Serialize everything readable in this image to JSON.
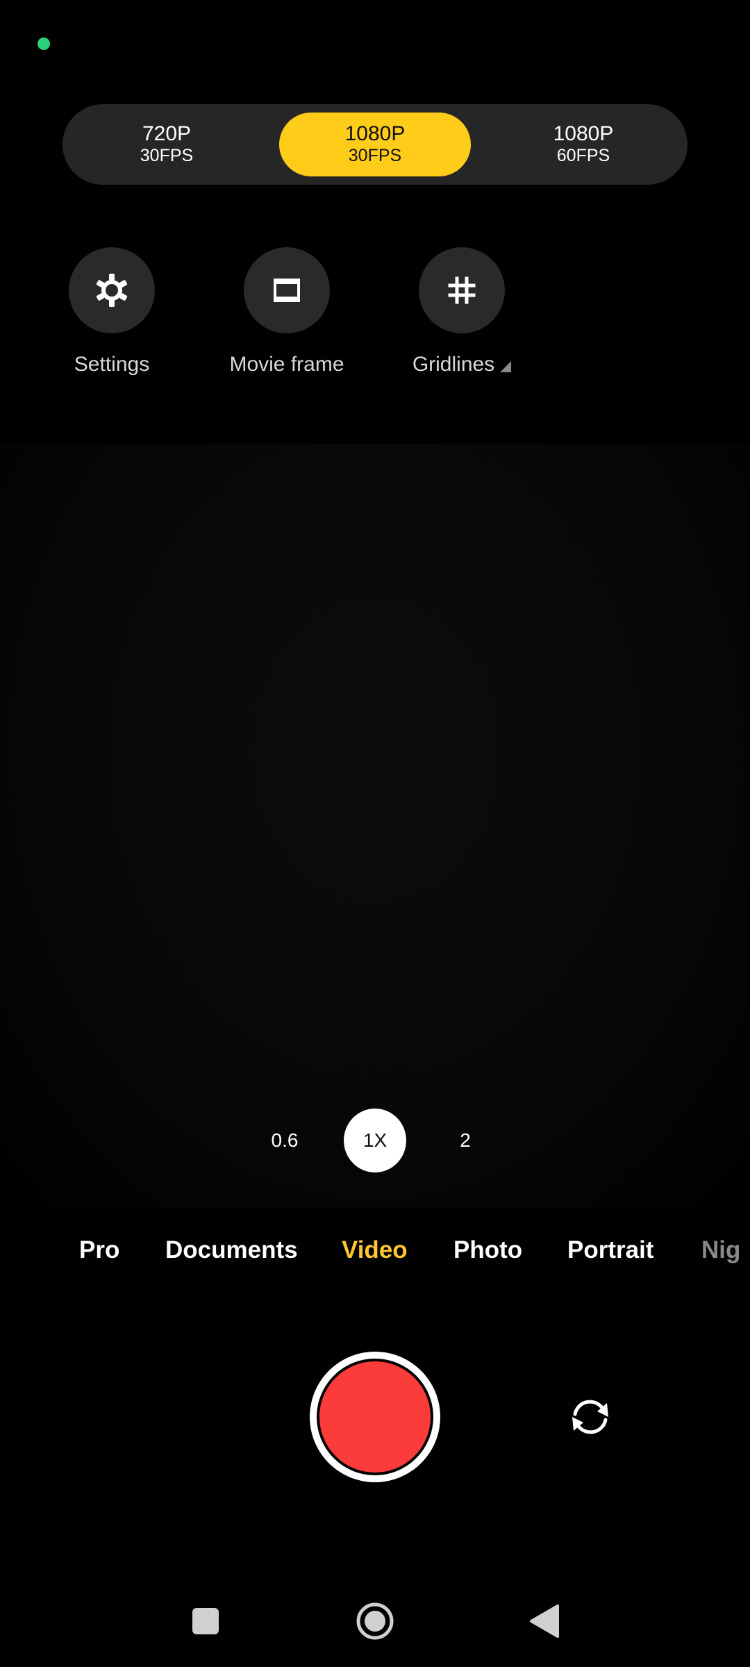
{
  "resolution_options": [
    {
      "main": "720P",
      "sub": "30FPS",
      "selected": false
    },
    {
      "main": "1080P",
      "sub": "30FPS",
      "selected": true
    },
    {
      "main": "1080P",
      "sub": "60FPS",
      "selected": false
    }
  ],
  "tools": {
    "settings": {
      "label": "Settings",
      "icon": "gear-icon"
    },
    "movie_frame": {
      "label": "Movie frame",
      "icon": "movie-frame-icon"
    },
    "gridlines": {
      "label": "Gridlines",
      "icon": "grid-icon"
    }
  },
  "zoom": {
    "wide": "0.6",
    "current": "1X",
    "tele": "2"
  },
  "modes": [
    "Pro",
    "Documents",
    "Video",
    "Photo",
    "Portrait",
    "Nig"
  ],
  "active_mode": "Video",
  "controls": {
    "shutter": "record-button",
    "flip": "flip-camera-icon"
  },
  "navigation": {
    "recents": "square-icon",
    "home": "home-icon",
    "back": "back-icon"
  },
  "colors": {
    "accent_yellow": "#ffcc1a",
    "record_red": "#fc3b3b",
    "status_green": "#2fd07a",
    "panel_dark": "#262626"
  }
}
